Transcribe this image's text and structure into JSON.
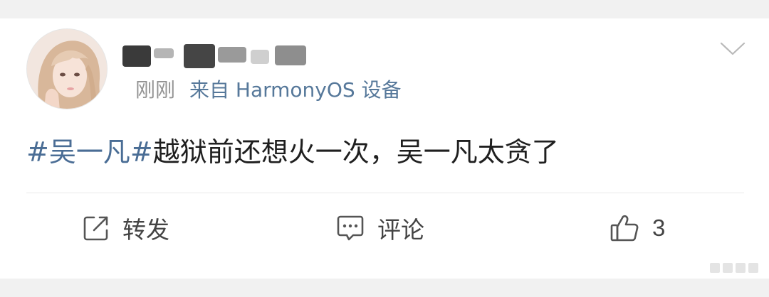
{
  "post": {
    "author": {
      "avatar_icon": "avatar-photo",
      "username_redacted": true
    },
    "meta": {
      "time": "刚刚",
      "source": "来自 HarmonyOS 设备"
    },
    "content": {
      "hashtag": "#吴一凡#",
      "text": "越狱前还想火一次，吴一凡太贪了"
    },
    "menu_icon": "chevron-down-icon",
    "actions": {
      "repost": {
        "icon": "share-box-icon",
        "label": "转发"
      },
      "comment": {
        "icon": "comment-bubble-icon",
        "label": "评论"
      },
      "like": {
        "icon": "thumbs-up-icon",
        "count": "3"
      }
    }
  },
  "colors": {
    "page_bg": "#f1f1f1",
    "card_bg": "#ffffff",
    "link_blue": "#4a6d95",
    "meta_gray": "#939393",
    "text_dark": "#1f1f1f"
  }
}
